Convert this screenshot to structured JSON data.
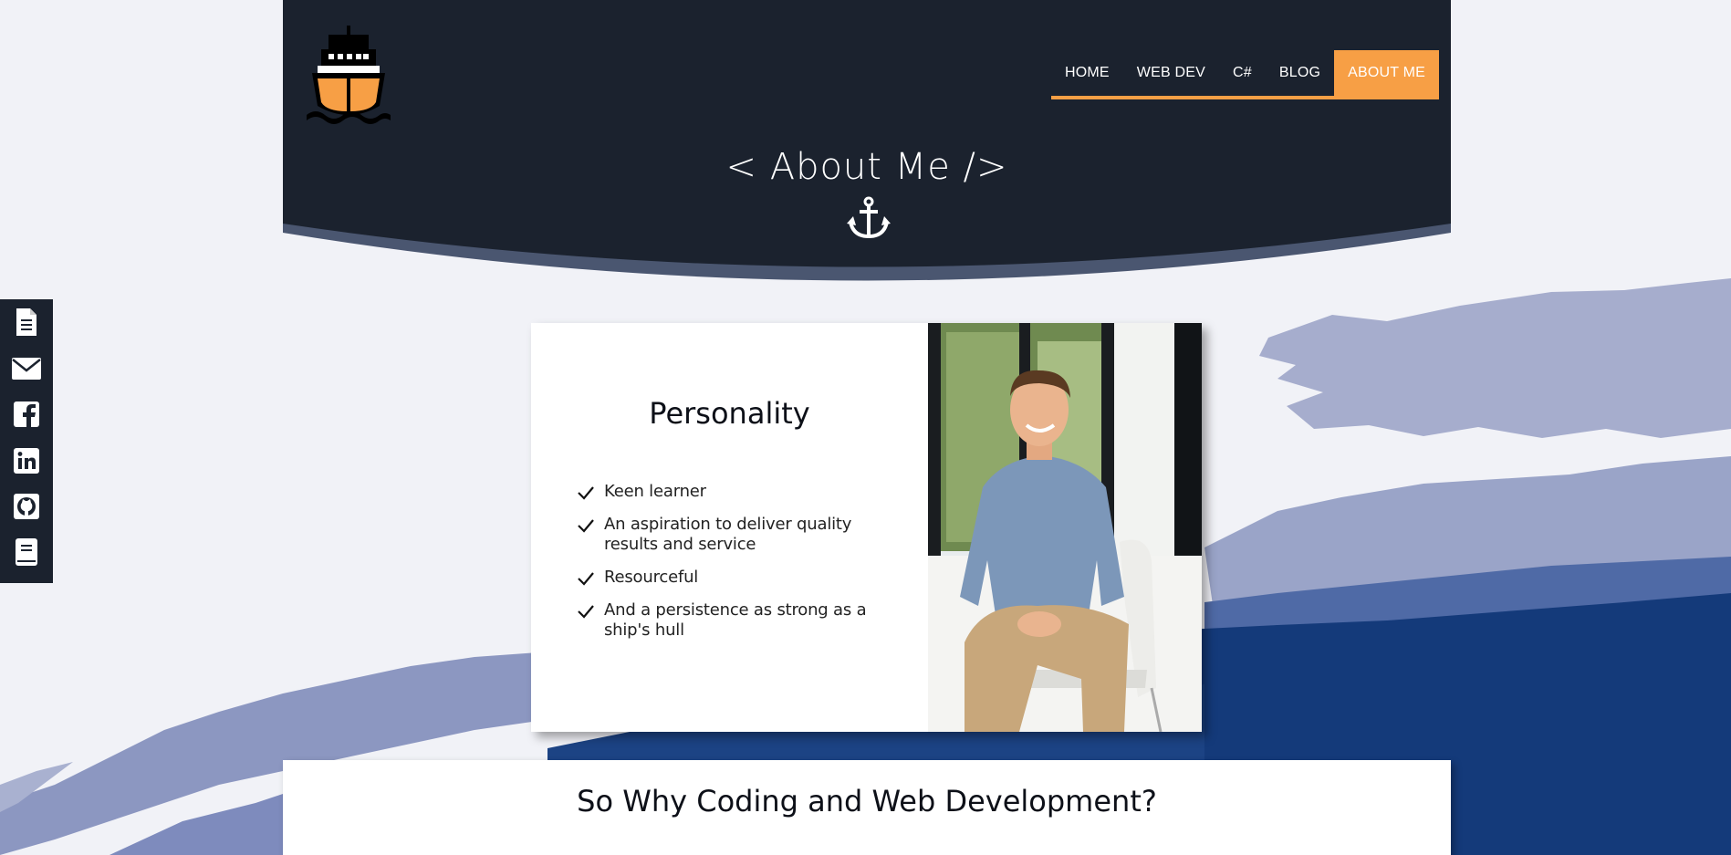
{
  "nav": {
    "items": [
      {
        "label": "HOME"
      },
      {
        "label": "WEB DEV"
      },
      {
        "label": "C#"
      },
      {
        "label": "BLOG"
      },
      {
        "label": "ABOUT ME"
      }
    ],
    "active_index": 4
  },
  "header": {
    "title": "< About Me />"
  },
  "social": {
    "icons": [
      "document-icon",
      "mail-icon",
      "facebook-icon",
      "linkedin-icon",
      "github-icon",
      "book-icon"
    ]
  },
  "personality": {
    "title": "Personality",
    "traits": [
      "Keen learner",
      "An aspiration to deliver quality results and service",
      "Resourceful",
      "And a persistence as strong as a ship's hull"
    ]
  },
  "why": {
    "title": "So Why Coding and Web Development?"
  },
  "colors": {
    "header_bg": "#1b222e",
    "accent": "#f79f45",
    "hull_shadow": "#4a5670",
    "page_bg": "#f1f2f7",
    "wave_light": "#a6adcd",
    "wave_mid": "#4f6aa6",
    "wave_dark": "#143a7a"
  }
}
